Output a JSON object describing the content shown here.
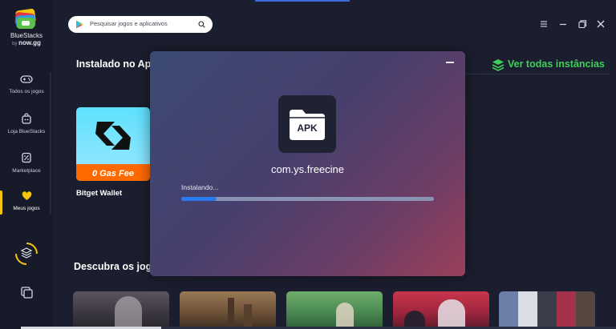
{
  "brand": {
    "name": "BlueStacks",
    "by": "by",
    "partner": "now.gg"
  },
  "sidebar": {
    "items": [
      {
        "label": "Todos os jogos",
        "icon": "gamepad-icon"
      },
      {
        "label": "Loja BlueStacks",
        "icon": "store-bag-icon"
      },
      {
        "label": "Marketplace",
        "icon": "discount-tag-icon"
      },
      {
        "label": "Meus jogos",
        "icon": "heart-icon",
        "active": true
      }
    ]
  },
  "search": {
    "placeholder": "Pesquisar jogos e aplicativos"
  },
  "installed": {
    "title": "Instalado no Ap",
    "see_all": "Ver todas instâncias",
    "apps": [
      {
        "name": "Bitget Wallet",
        "badge": "0 Gas Fee"
      }
    ]
  },
  "discover": {
    "title": "Descubra os jog"
  },
  "modal": {
    "icon_label": "APK",
    "package": "com.ys.freecine",
    "status": "Instalando...",
    "progress": 0.14
  },
  "colors": {
    "accent_green": "#3fcf5a",
    "active_yellow": "#f2c511",
    "progress_blue": "#2b7bf0",
    "badge_orange": "#ff6a00"
  }
}
